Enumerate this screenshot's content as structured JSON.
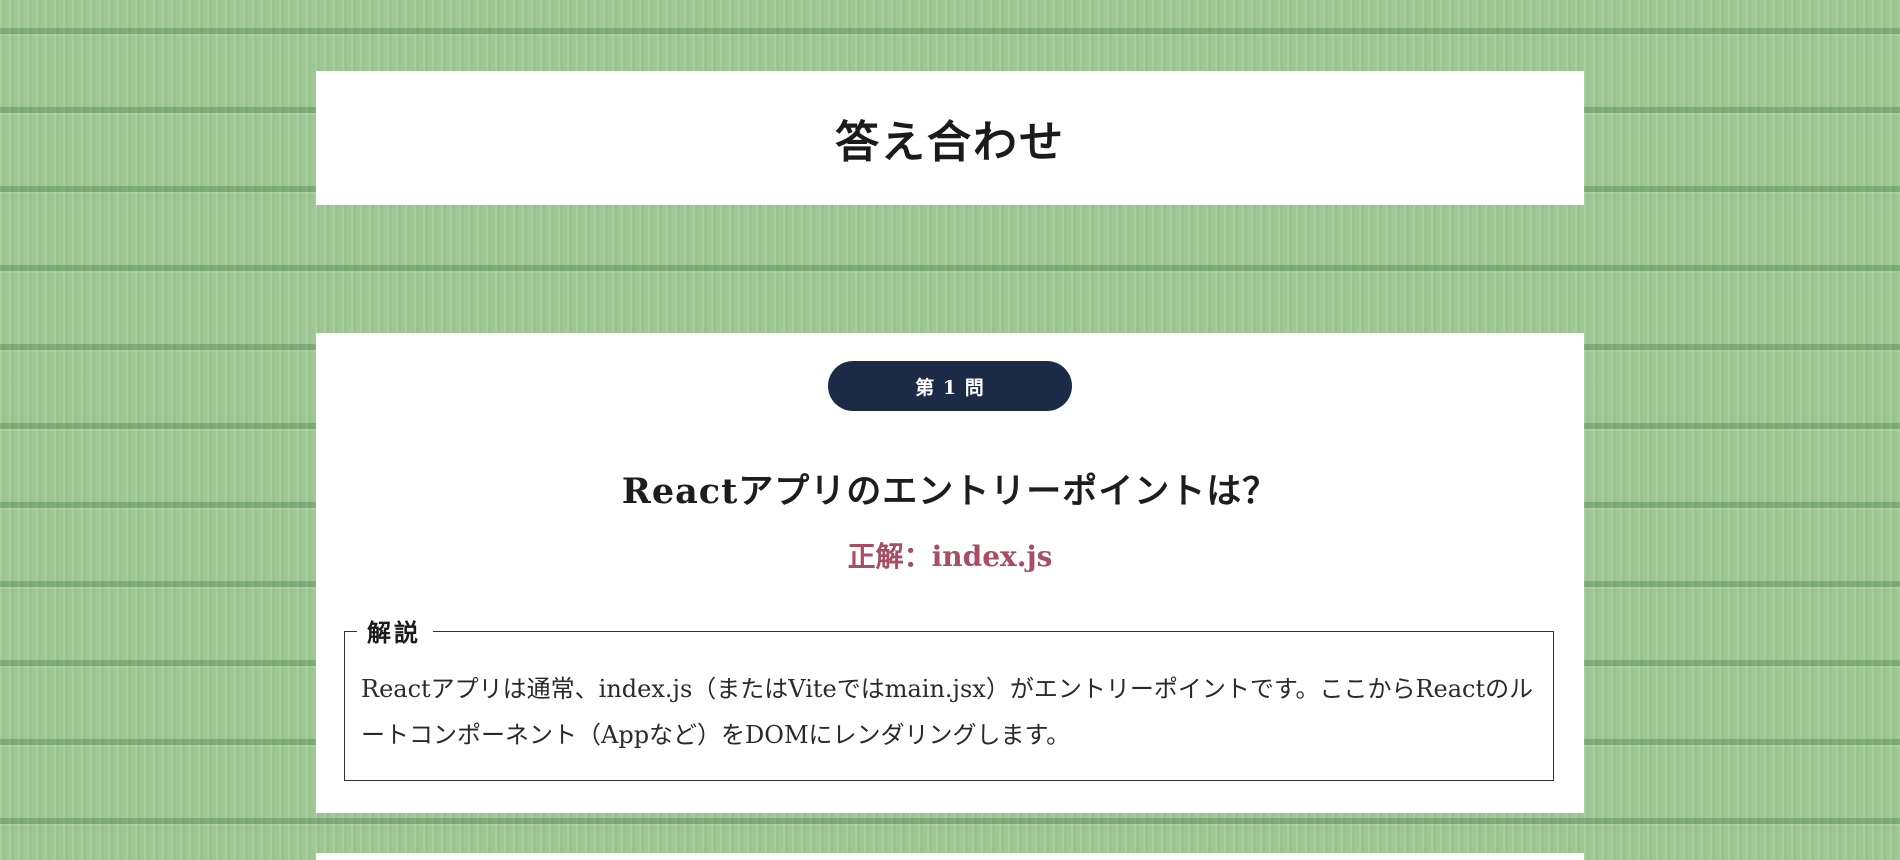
{
  "header": {
    "title": "答え合わせ"
  },
  "question": {
    "badge": "第 1 問",
    "text": "Reactアプリのエントリーポイントは？",
    "answer": "正解：index.js",
    "explanation": {
      "legend": "解説",
      "body": "Reactアプリは通常、index.js（またはViteではmain.jsx）がエントリーポイントです。ここからReactのルートコンポーネント（Appなど）をDOMにレンダリングします。"
    }
  },
  "colors": {
    "background": "#9fc793",
    "badge": "#1c2b45",
    "answer": "#a84d63"
  }
}
